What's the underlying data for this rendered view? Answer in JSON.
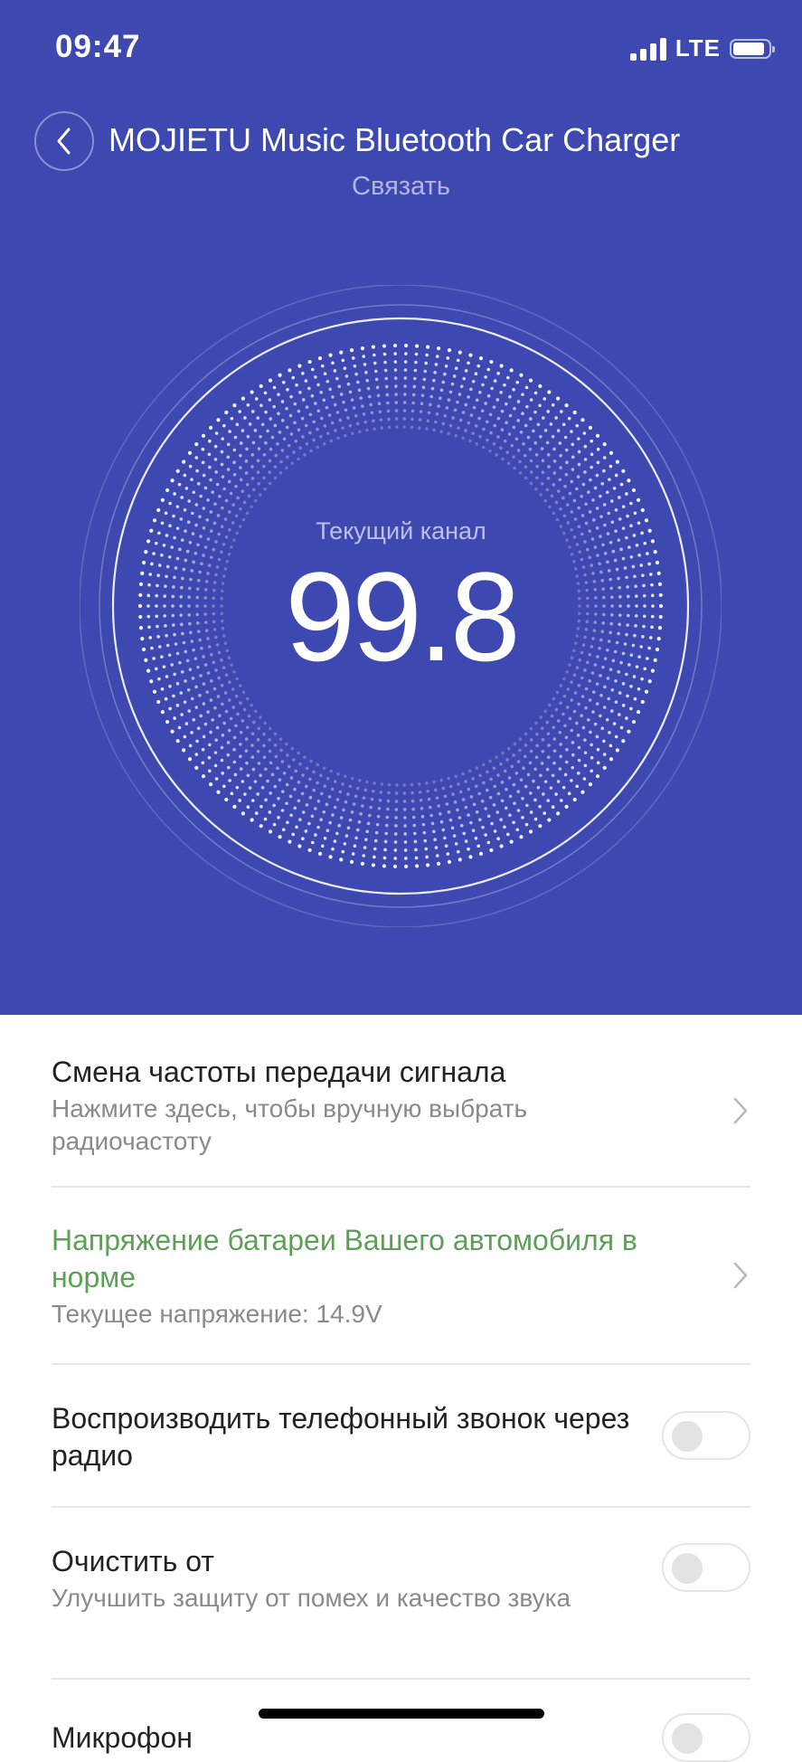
{
  "status_bar": {
    "time": "09:47",
    "network": "LTE"
  },
  "header": {
    "title": "MOJIETU Music Bluetooth Car Charger",
    "subtitle": "Связать"
  },
  "dial": {
    "label": "Текущий канал",
    "value": "99.8"
  },
  "settings": {
    "frequency": {
      "title": "Смена частоты передачи сигнала",
      "description": "Нажмите здесь, чтобы вручную выбрать радиочастоту"
    },
    "voltage": {
      "title": "Напряжение батареи Вашего автомобиля в норме",
      "description": "Текущее напряжение: 14.9V"
    },
    "call_via_radio": {
      "title": "Воспроизводить телефонный звонок через радио",
      "enabled": false
    },
    "noise_clean": {
      "title": "Очистить от",
      "description": "Улучшить защиту от помех и качество звука",
      "enabled": false
    },
    "microphone": {
      "title": "Микрофон",
      "enabled": false
    }
  },
  "colors": {
    "header_bg": "#3d48b0",
    "ok_status": "#5e9f58",
    "divider": "#e7e7e7"
  },
  "icons": {
    "back": "chevron-left-icon",
    "row_nav": "chevron-right-icon"
  }
}
